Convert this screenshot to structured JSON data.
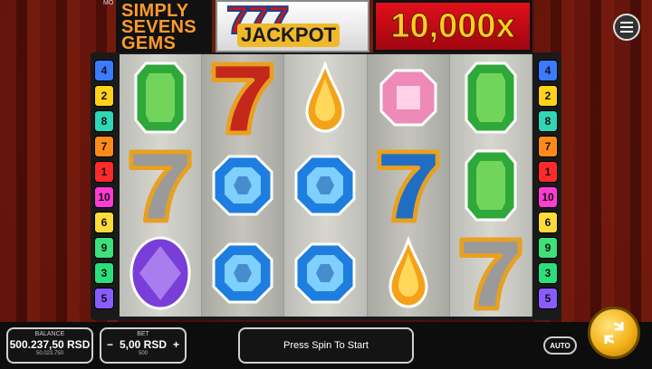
{
  "game": {
    "title_lines": [
      "SIMPLY",
      "SEVENS",
      "GEMS"
    ],
    "jackpot_sevens": "777",
    "jackpot_label": "JACKPOT",
    "multiplier": "10,000x",
    "corner_text": "MO"
  },
  "paylines_left": [
    {
      "n": "4",
      "color": "#3a7bff"
    },
    {
      "n": "2",
      "color": "#ffd21a"
    },
    {
      "n": "8",
      "color": "#30d6b6"
    },
    {
      "n": "7",
      "color": "#ff8a1a"
    },
    {
      "n": "1",
      "color": "#ff2a2a"
    },
    {
      "n": "10",
      "color": "#ff3cd2"
    },
    {
      "n": "6",
      "color": "#ffdb3a"
    },
    {
      "n": "9",
      "color": "#3ee07a"
    },
    {
      "n": "3",
      "color": "#2be07a"
    },
    {
      "n": "5",
      "color": "#8a5cff"
    }
  ],
  "paylines_right": [
    {
      "n": "4",
      "color": "#3a7bff"
    },
    {
      "n": "2",
      "color": "#ffd21a"
    },
    {
      "n": "8",
      "color": "#30d6b6"
    },
    {
      "n": "7",
      "color": "#ff8a1a"
    },
    {
      "n": "1",
      "color": "#ff2a2a"
    },
    {
      "n": "10",
      "color": "#ff3cd2"
    },
    {
      "n": "6",
      "color": "#ffdb3a"
    },
    {
      "n": "9",
      "color": "#3ee07a"
    },
    {
      "n": "3",
      "color": "#2be07a"
    },
    {
      "n": "5",
      "color": "#8a5cff"
    }
  ],
  "reels": [
    [
      "green-gem",
      "seven-gray",
      "purple-gem"
    ],
    [
      "seven-red",
      "blue-gem",
      "blue-gem"
    ],
    [
      "orange-drop",
      "blue-gem",
      "blue-gem"
    ],
    [
      "pink-gem",
      "seven-blue",
      "orange-drop"
    ],
    [
      "green-gem",
      "green-gem",
      "seven-gray"
    ]
  ],
  "balance": {
    "label": "BALANCE",
    "value": "500.237,50 RSD",
    "sub": "50.023.750"
  },
  "bet": {
    "label": "BET",
    "minus": "−",
    "value": "5,00 RSD",
    "plus": "+",
    "sub": "500"
  },
  "status_message": "Press Spin To Start",
  "auto_label": "AUTO",
  "icons": {
    "menu": "hamburger-menu-icon",
    "spin": "spin-arrows-icon"
  }
}
